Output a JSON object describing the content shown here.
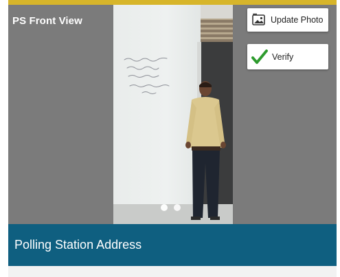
{
  "panel": {
    "title": "PS Front View",
    "accent_color": "#d7b52a",
    "background_color": "#7b7b7b"
  },
  "actions": {
    "update_photo_label": "Update Photo",
    "update_photo_icon": "photo-icon",
    "verify_label": "Verify",
    "verify_icon": "checkmark-icon",
    "verify_color": "#2e9b2e"
  },
  "carousel": {
    "page_count": 2,
    "current_page": 1
  },
  "address": {
    "label": "Polling Station Address",
    "bar_color": "#0f5f80"
  }
}
